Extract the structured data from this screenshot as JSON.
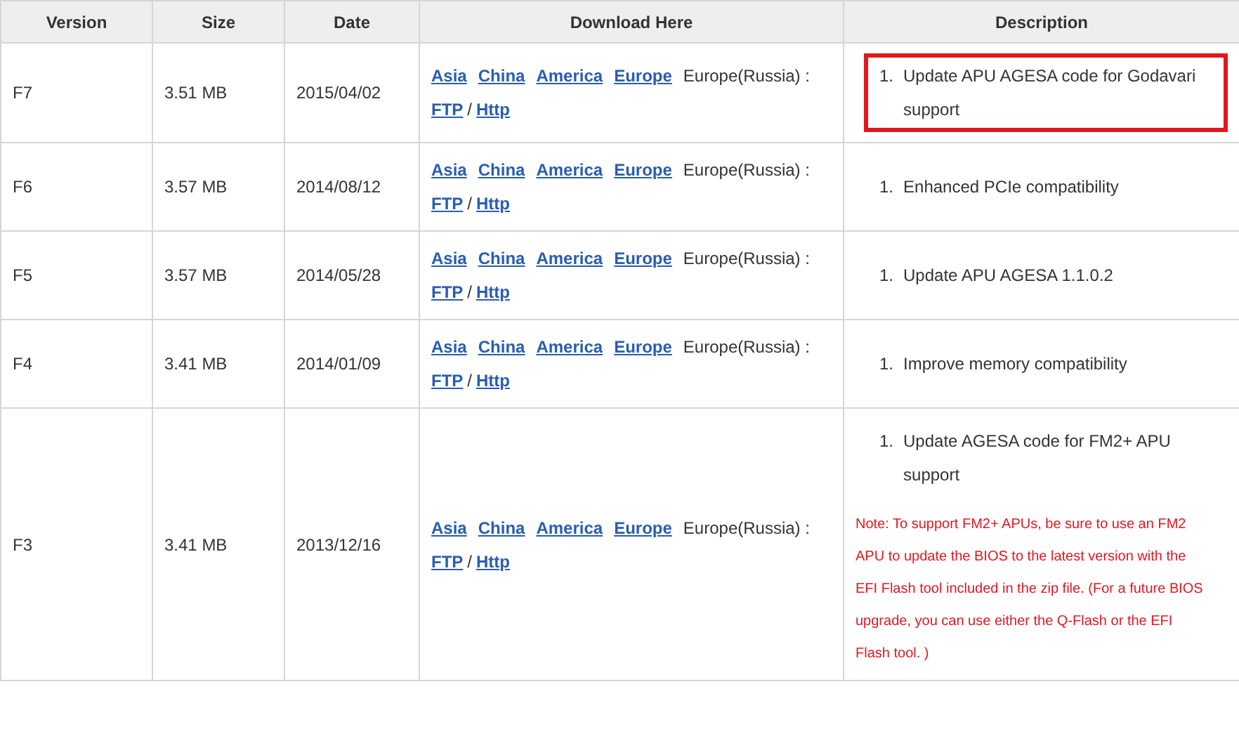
{
  "table": {
    "columns": [
      "Version",
      "Size",
      "Date",
      "Download Here",
      "Description"
    ],
    "rows": [
      {
        "version": "F7",
        "size": "3.51 MB",
        "date": "2015/04/02",
        "links": [
          "Asia",
          "China",
          "America",
          "Europe"
        ],
        "other": "Europe(Russia) :",
        "protocols": [
          "FTP",
          "Http"
        ],
        "separator": "/",
        "items": [
          {
            "number": "1.",
            "text": "Update APU AGESA code for Godavari support"
          }
        ],
        "highlighted": true
      },
      {
        "version": "F6",
        "size": "3.57 MB",
        "date": "2014/08/12",
        "links": [
          "Asia",
          "China",
          "America",
          "Europe"
        ],
        "other": "Europe(Russia) :",
        "protocols": [
          "FTP",
          "Http"
        ],
        "separator": "/",
        "items": [
          {
            "number": "1.",
            "text": "Enhanced PCIe compatibility"
          }
        ],
        "highlighted": false
      },
      {
        "version": "F5",
        "size": "3.57 MB",
        "date": "2014/05/28",
        "links": [
          "Asia",
          "China",
          "America",
          "Europe"
        ],
        "other": "Europe(Russia) :",
        "protocols": [
          "FTP",
          "Http"
        ],
        "separator": "/",
        "items": [
          {
            "number": "1.",
            "text": "Update APU AGESA 1.1.0.2"
          }
        ],
        "highlighted": false
      },
      {
        "version": "F4",
        "size": "3.41 MB",
        "date": "2014/01/09",
        "links": [
          "Asia",
          "China",
          "America",
          "Europe"
        ],
        "other": "Europe(Russia) :",
        "protocols": [
          "FTP",
          "Http"
        ],
        "separator": "/",
        "items": [
          {
            "number": "1.",
            "text": "Improve memory compatibility"
          }
        ],
        "highlighted": false
      },
      {
        "version": "F3",
        "size": "3.41 MB",
        "date": "2013/12/16",
        "links": [
          "Asia",
          "China",
          "America",
          "Europe"
        ],
        "other": "Europe(Russia) :",
        "protocols": [
          "FTP",
          "Http"
        ],
        "separator": "/",
        "items": [
          {
            "number": "1.",
            "text": "Update AGESA code for FM2+ APU support"
          }
        ],
        "note": "Note: To support FM2+ APUs, be sure to use an FM2 APU to update the BIOS to the latest version with the EFI Flash tool included in the zip file. (For a future BIOS upgrade, you can use either the Q-Flash or the EFI Flash tool. )",
        "highlighted": false
      }
    ]
  }
}
